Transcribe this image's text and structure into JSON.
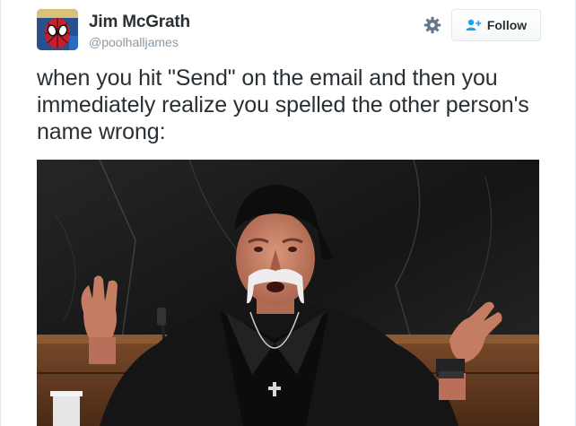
{
  "tweet": {
    "author": {
      "display_name": "Jim McGrath",
      "handle": "@poolhalljames"
    },
    "follow_label": "Follow",
    "settings_icon": "gear-icon",
    "follow_icon": "add-user-icon",
    "text": "when you hit \"Send\" on the email and then you immediately realize you spelled the other person's name wrong:"
  },
  "colors": {
    "accent": "#1da1f2",
    "text": "#292f33",
    "muted": "#8899a6",
    "border": "#e1e8ed"
  }
}
